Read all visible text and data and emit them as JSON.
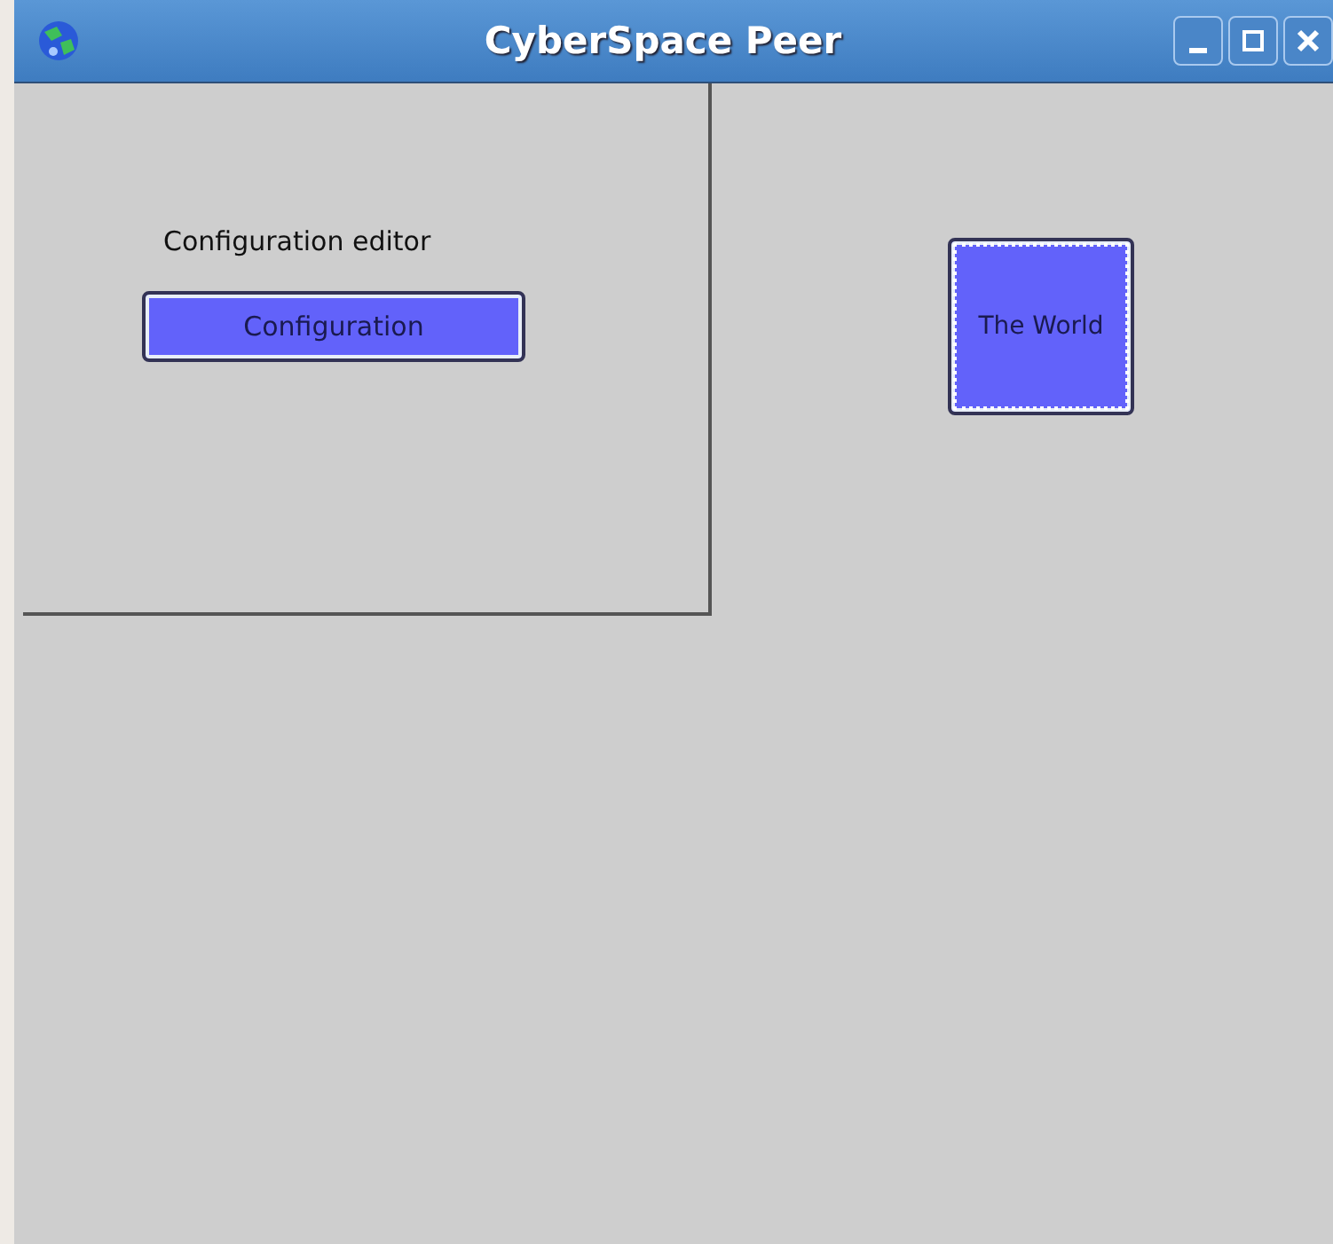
{
  "window": {
    "title": "CyberSpace Peer",
    "controls": [
      {
        "kind": "minimize"
      },
      {
        "kind": "maximize"
      },
      {
        "kind": "close"
      }
    ]
  },
  "config_panel": {
    "label": "Configuration editor",
    "button": {
      "label": "Configuration",
      "focused": false
    }
  },
  "world_button": {
    "label": "The World",
    "focused": true
  }
}
